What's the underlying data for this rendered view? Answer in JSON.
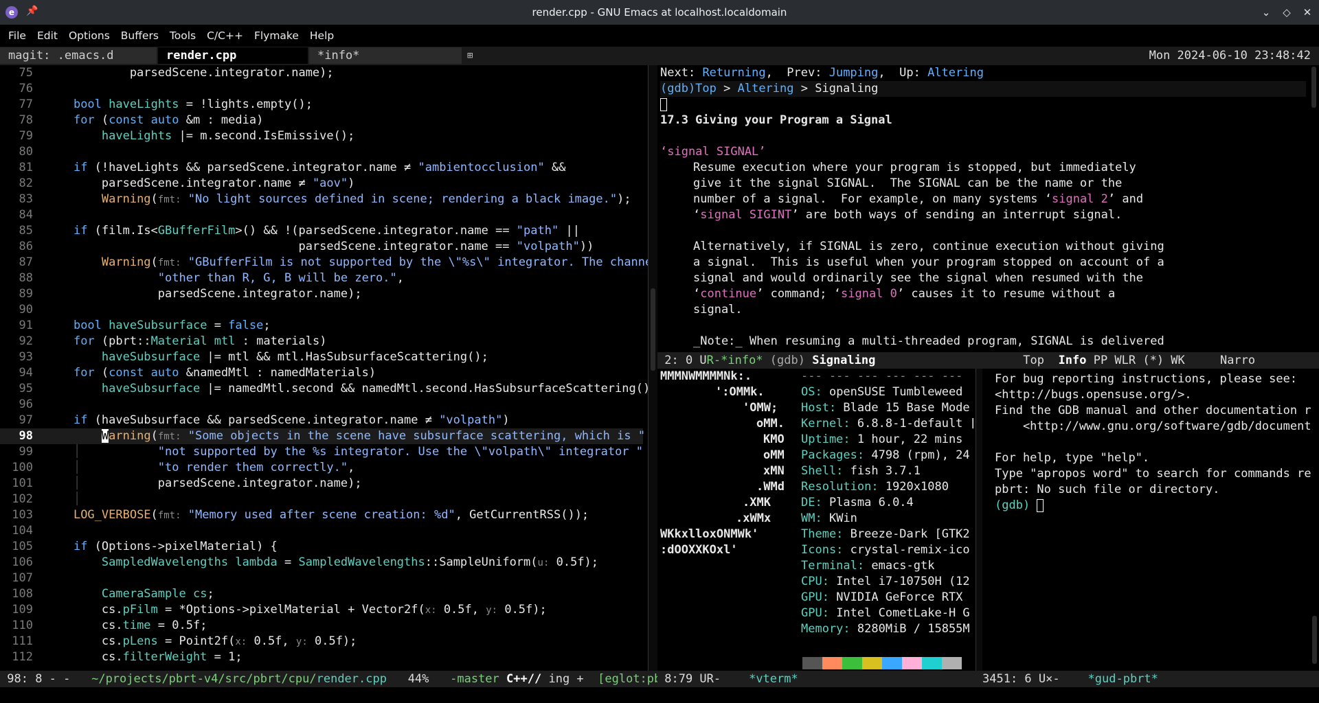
{
  "window": {
    "title": "render.cpp - GNU Emacs at localhost.localdomain",
    "app_icon_letter": "e"
  },
  "menu": [
    "File",
    "Edit",
    "Options",
    "Buffers",
    "Tools",
    "C/C++",
    "Flymake",
    "Help"
  ],
  "tabs": [
    {
      "label": "magit: .emacs.d"
    },
    {
      "label": "render.cpp"
    },
    {
      "label": "*info*"
    }
  ],
  "tab_add": "⊞",
  "clock": "Mon 2024-06-10 23:48:42",
  "editor": {
    "line_numbers": [
      "75",
      "76",
      "77",
      "78",
      "79",
      "80",
      "81",
      "82",
      "83",
      "84",
      "85",
      "86",
      "87",
      "88",
      "89",
      "90",
      "91",
      "92",
      "93",
      "94",
      "95",
      "96",
      "97",
      "98",
      "99",
      "100",
      "101",
      "102",
      "103",
      "104",
      "105",
      "106",
      "107",
      "108",
      "109",
      "110",
      "111",
      "112"
    ],
    "current_line": "98",
    "modeline": {
      "pos": "98: 8 - -",
      "path": "~/projects/pbrt-v4/src/pbrt/cpu/",
      "file": "render.cpp",
      "percent": "44%",
      "branch": "-master",
      "mode": "C++//",
      "extra": "ing +",
      "eglot": "[eglot:pbrt"
    }
  },
  "info": {
    "nav_next_label": "Next:",
    "nav_next": "Returning",
    "nav_prev_label": "Prev:",
    "nav_prev": "Jumping",
    "nav_up_label": "Up:",
    "nav_up": "Altering",
    "breadcrumb_root": "(gdb)Top",
    "breadcrumb_sep": " > ",
    "breadcrumb_mid": "Altering",
    "breadcrumb_leaf": "Signaling",
    "heading": "17.3 Giving your Program a Signal",
    "cmd_open": "‘signal SIGNAL’",
    "lines": [
      "Resume execution where your program is stopped, but immediately",
      "give it the signal SIGNAL.  The SIGNAL can be the name or the",
      "number of a signal.  For example, on many systems",
      "are both ways of sending an interrupt signal.",
      "Alternatively, if SIGNAL is zero, continue execution without giving",
      "a signal.  This is useful when your program stopped on account of a",
      "signal and would ordinarily see the signal when resumed with the",
      "command;",
      "causes it to resume without a",
      "signal.",
      "_Note:_ When resuming a multi-threaded program, SIGNAL is delivered"
    ],
    "code_sig2": "signal 2",
    "code_sigint": "signal SIGINT",
    "code_continue": "continue",
    "code_sig0": "signal 0",
    "and": "and",
    "modeline": {
      "pos": " 2: 0 U",
      "buf": "R-*info*",
      "node": "(gdb) Signaling",
      "top": "Top",
      "mode": "Info",
      "flags": "PP WLR (*) WK",
      "narrow": "Narro"
    }
  },
  "vterm": {
    "logo": [
      "MMMNWMMMMNk:.",
      "':OMMk.",
      "'OMW;",
      "oMM.",
      "KMO",
      "oMM",
      "xMN",
      ".WMd",
      ".XMK",
      ".xWMx",
      "WKkxlloxONMWk'",
      ":dOOXXKOxl'"
    ],
    "separator": "--- --- --- --- --- ---",
    "info": [
      {
        "k": "OS:",
        "v": "openSUSE Tumbleweed"
      },
      {
        "k": "Host:",
        "v": "Blade 15 Base Mode"
      },
      {
        "k": "Kernel:",
        "v": "6.8.8-1-default ["
      },
      {
        "k": "Uptime:",
        "v": "1 hour, 22 mins"
      },
      {
        "k": "Packages:",
        "v": "4798 (rpm), 24"
      },
      {
        "k": "Shell:",
        "v": "fish 3.7.1"
      },
      {
        "k": "Resolution:",
        "v": "1920x1080"
      },
      {
        "k": "DE:",
        "v": "Plasma 6.0.4"
      },
      {
        "k": "WM:",
        "v": "KWin"
      },
      {
        "k": "Theme:",
        "v": "Breeze-Dark [GTK2"
      },
      {
        "k": "Icons:",
        "v": "crystal-remix-ico"
      },
      {
        "k": "Terminal:",
        "v": "emacs-gtk"
      },
      {
        "k": "CPU:",
        "v": "Intel i7-10750H (12"
      },
      {
        "k": "GPU:",
        "v": "NVIDIA GeForce RTX"
      },
      {
        "k": "GPU:",
        "v": "Intel CometLake-H G"
      },
      {
        "k": "Memory:",
        "v": "8280MiB / 15855M"
      }
    ],
    "swatch_colors": [
      "#555555",
      "#ff8a5c",
      "#3cc03c",
      "#d8c020",
      "#3aa8ff",
      "#ffb0d8",
      "#20d0d0",
      "#b0b0b0"
    ],
    "modeline": {
      "pos": " 8:79 UR-",
      "buf": "*vterm*"
    }
  },
  "gud": {
    "lines": [
      "For bug reporting instructions, please see:",
      "<http://bugs.opensuse.org/>.",
      "Find the GDB manual and other documentation r",
      "    <http://www.gnu.org/software/gdb/document",
      "",
      "For help, type \"help\".",
      "Type \"apropos word\" to search for commands re",
      "pbrt: No such file or directory."
    ],
    "prompt": "(gdb)",
    "modeline": {
      "pos": "3451: 6 U×-",
      "buf": "*gud-pbrt*"
    }
  }
}
